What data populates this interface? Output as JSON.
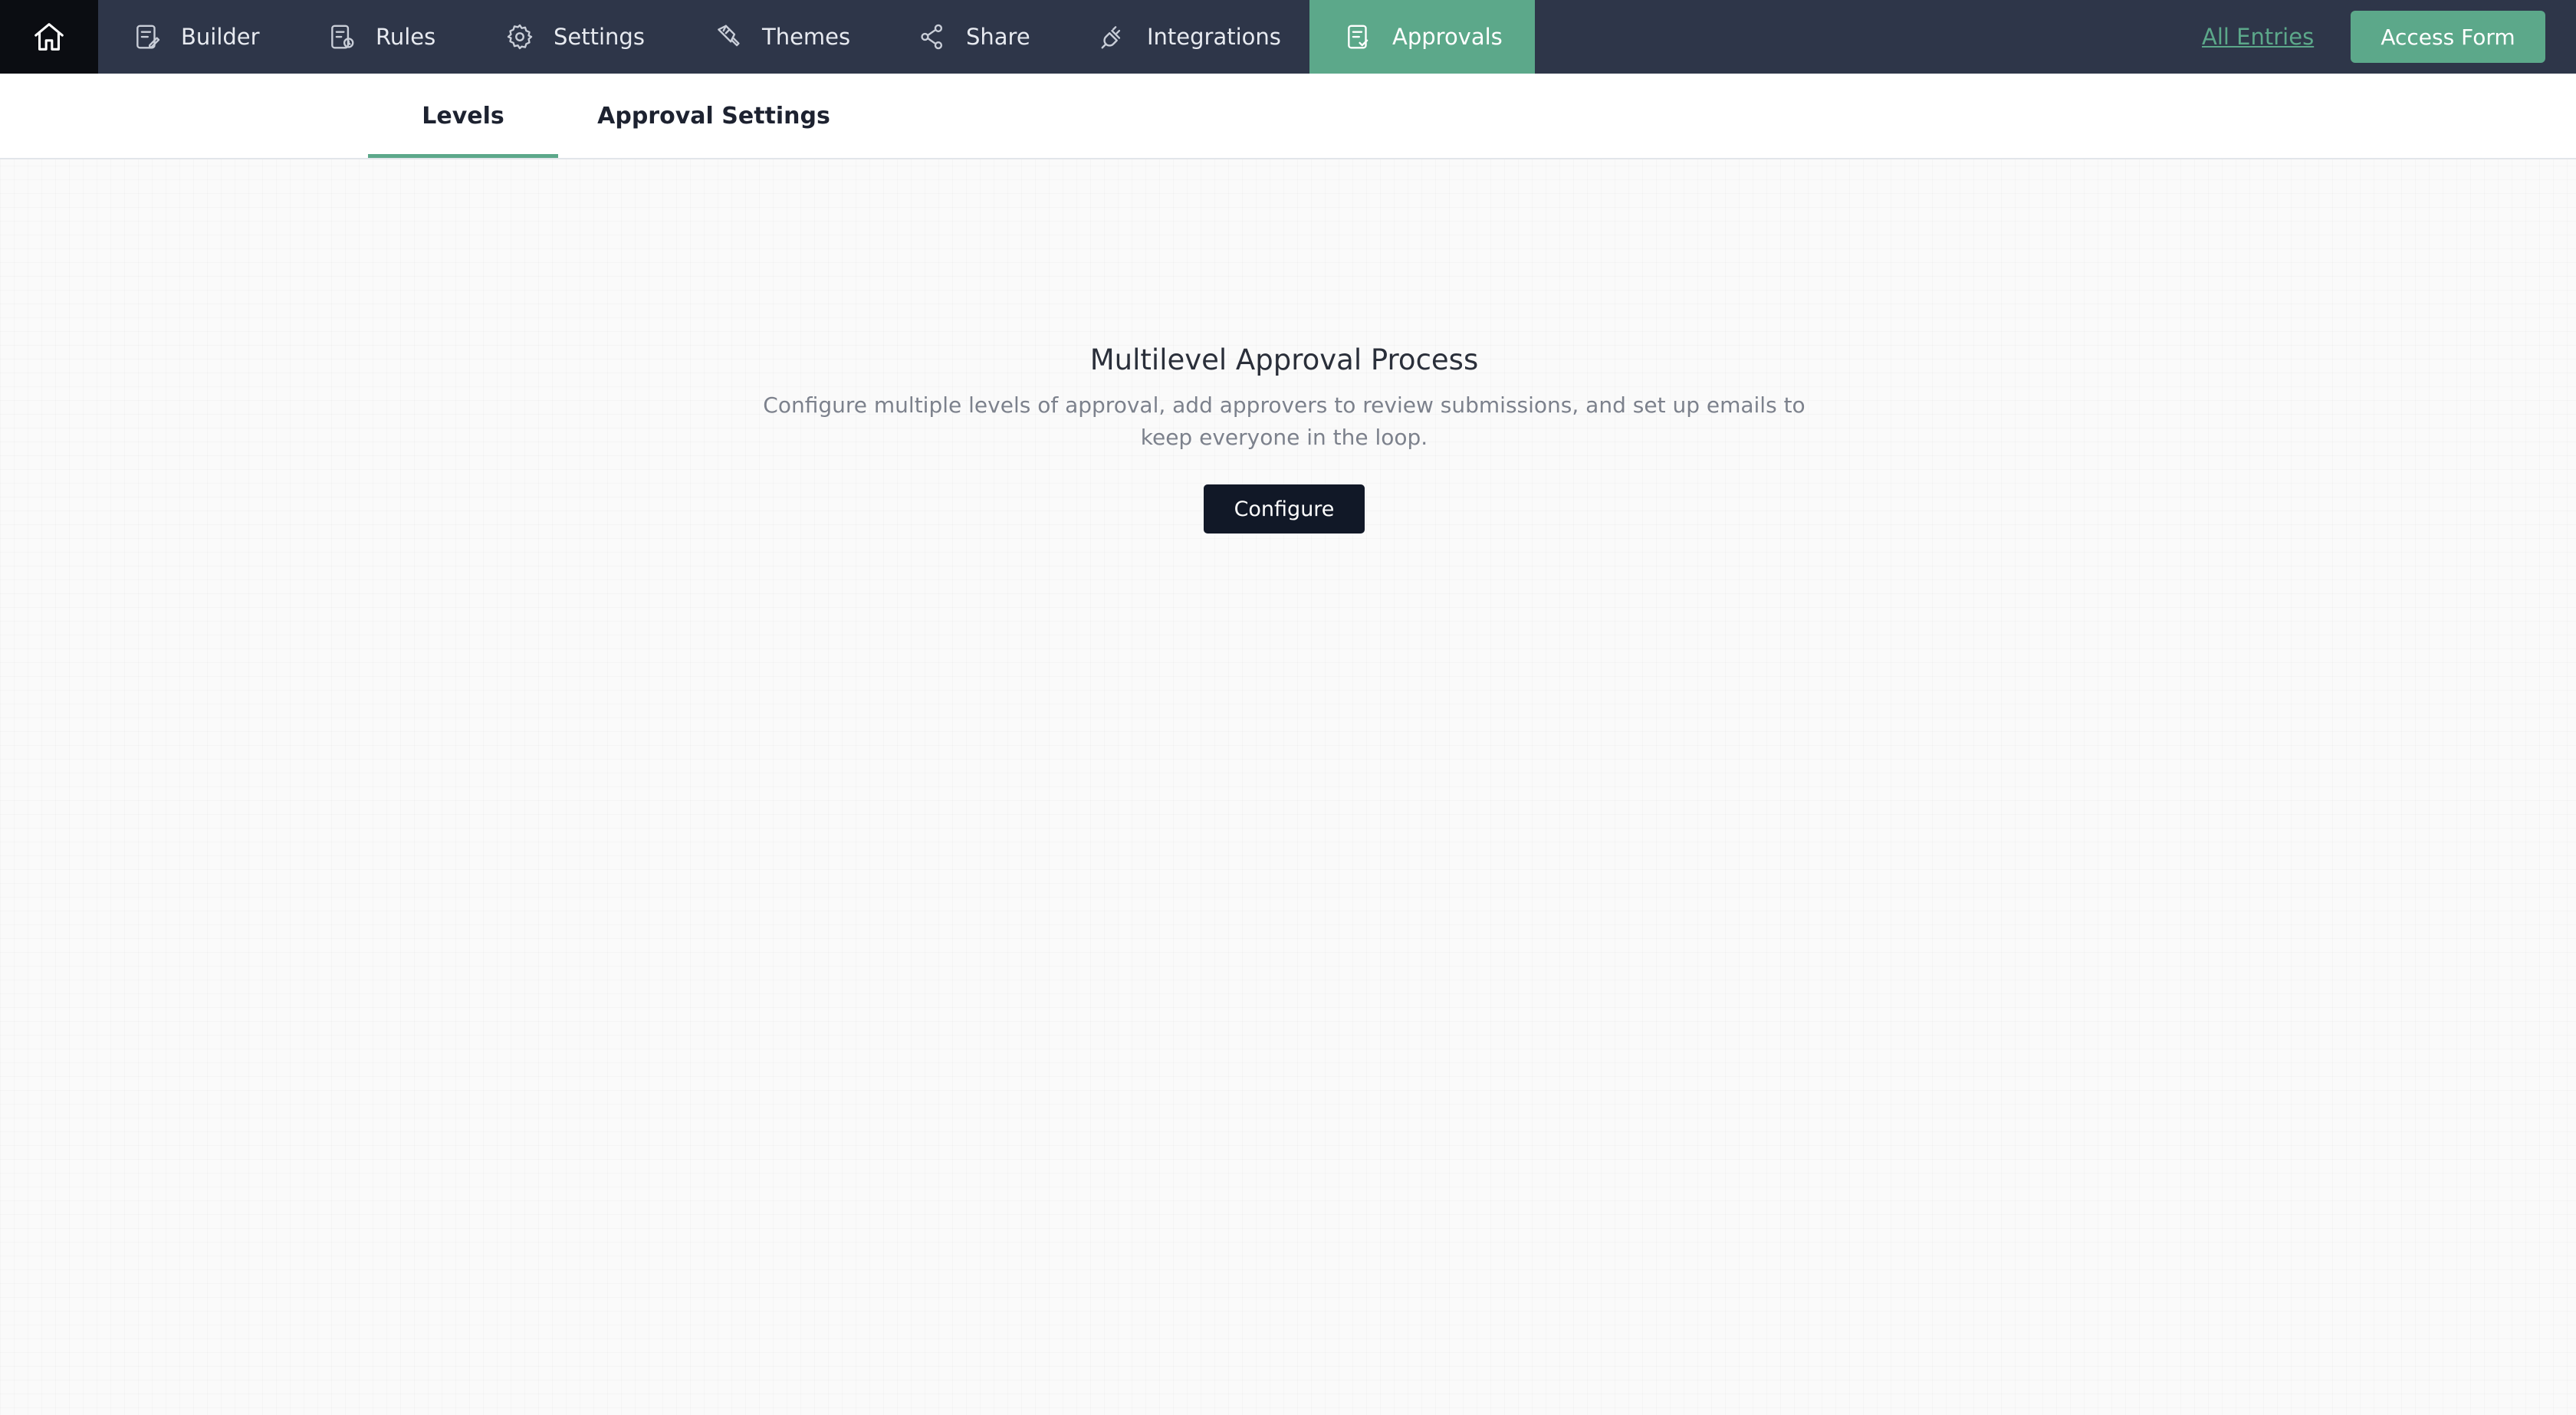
{
  "nav": {
    "home_icon": "home-icon",
    "items": [
      {
        "label": "Builder",
        "icon": "form-builder-icon"
      },
      {
        "label": "Rules",
        "icon": "rules-icon"
      },
      {
        "label": "Settings",
        "icon": "gear-icon"
      },
      {
        "label": "Themes",
        "icon": "paint-brush-icon"
      },
      {
        "label": "Share",
        "icon": "share-icon"
      },
      {
        "label": "Integrations",
        "icon": "plug-icon"
      },
      {
        "label": "Approvals",
        "icon": "approval-checklist-icon",
        "active": true
      }
    ],
    "all_entries_label": "All Entries",
    "access_form_label": "Access Form"
  },
  "tabs": [
    {
      "label": "Levels",
      "active": true
    },
    {
      "label": "Approval Settings",
      "active": false
    }
  ],
  "empty_state": {
    "title": "Multilevel Approval Process",
    "description": "Configure multiple levels of approval, add approvers to review submissions, and set up emails to keep everyone in the loop.",
    "button_label": "Configure"
  },
  "colors": {
    "topbar": "#2e3649",
    "accent": "#5ca88a",
    "home_bg": "#0b0d12",
    "primary_button": "#111827"
  }
}
